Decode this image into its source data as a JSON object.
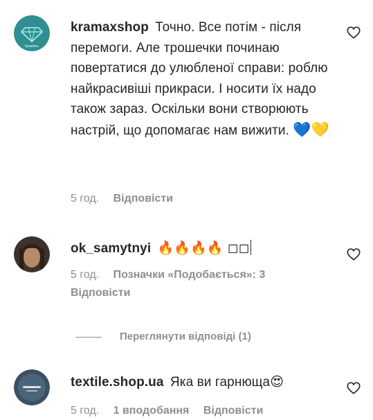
{
  "comments": [
    {
      "username": "kramaxshop",
      "avatar_text": "КрамАкс",
      "text": "Точно. Все потім - після перемоги. Але трошечки починаю повертатися до улюбленої справи: роблю найкрасивіші прикраси. І носити їх надо також зараз. Оскільки вони створюють настрій, що допомагає нам вижити.",
      "emoji": "💙💛",
      "time": "5 год.",
      "reply_label": "Відповісти"
    },
    {
      "username": "ok_samytnyi",
      "text": "🔥🔥🔥🔥 ◻◻",
      "time": "5 год.",
      "likes_label": "Позначки «Подобається»: 3",
      "reply_label": "Відповісти",
      "view_replies_label": "Переглянути відповіді (1)"
    },
    {
      "username": "textile.shop.ua",
      "text": "Яка ви гарнюща😍",
      "time": "5 год.",
      "likes_label": "1 вподобання",
      "reply_label": "Відповісти"
    }
  ],
  "icons": {
    "like": "heart-outline-icon"
  },
  "colors": {
    "text": "#262626",
    "secondary": "#8e8e8e",
    "avatar1_bg": "#2f8f92",
    "avatar3_bg": "#3a4f61"
  }
}
